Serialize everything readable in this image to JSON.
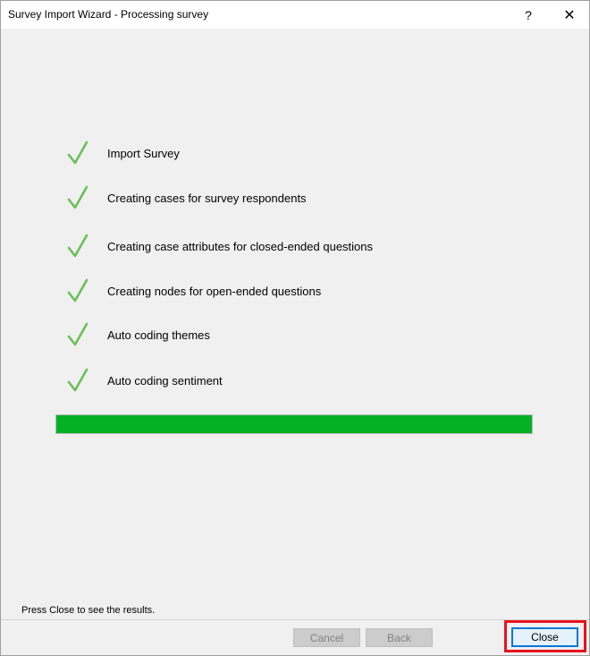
{
  "window": {
    "title": "Survey Import Wizard - Processing survey",
    "help_label": "?",
    "close_label": "✕"
  },
  "steps": [
    {
      "label": "Import Survey",
      "status": "done"
    },
    {
      "label": "Creating cases for survey respondents",
      "status": "done"
    },
    {
      "label": "Creating case attributes for closed-ended questions",
      "status": "done"
    },
    {
      "label": "Creating nodes for open-ended questions",
      "status": "done"
    },
    {
      "label": "Auto coding themes",
      "status": "done"
    },
    {
      "label": "Auto coding sentiment",
      "status": "done"
    }
  ],
  "progress": {
    "value": 1.0
  },
  "footer": {
    "hint": "Press Close to see the results.",
    "cancel_label": "Cancel",
    "back_label": "Back",
    "close_label": "Close"
  },
  "colors": {
    "check": "#6bbf59",
    "progress": "#06b025",
    "highlight": "#e8121c"
  }
}
